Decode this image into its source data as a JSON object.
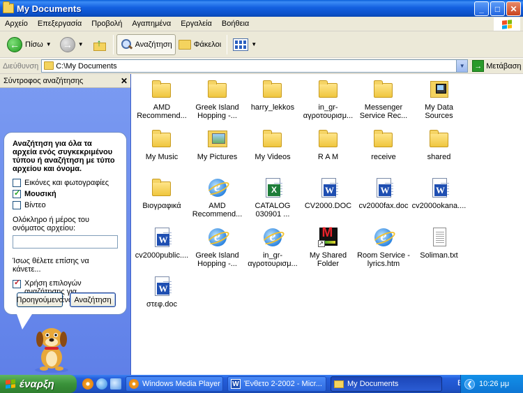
{
  "window": {
    "title": "My Documents",
    "min": "_",
    "max": "□",
    "close": "✕"
  },
  "menu": [
    "Αρχείο",
    "Επεξεργασία",
    "Προβολή",
    "Αγαπημένα",
    "Εργαλεία",
    "Βοήθεια"
  ],
  "toolbar": {
    "back": "Πίσω",
    "search": "Αναζήτηση",
    "folders": "Φάκελοι"
  },
  "address": {
    "label": "Διεύθυνση",
    "value": "C:\\My Documents",
    "go": "Μετάβαση"
  },
  "search_pane": {
    "title": "Σύντροφος αναζήτησης",
    "close": "✕",
    "heading": "Αναζήτηση για όλα τα αρχεία ενός συγκεκριμένου τύπου ή αναζήτηση με τύπο αρχείου και όνομα.",
    "options": [
      {
        "label": "Εικόνες και φωτογραφίες",
        "checked": false,
        "bold": false
      },
      {
        "label": "Μουσική",
        "checked": true,
        "bold": true
      },
      {
        "label": "Βίντεο",
        "checked": false,
        "bold": false
      }
    ],
    "name_label": "Ολόκληρο ή μέρος του ονόματος αρχείου:",
    "name_value": "",
    "maybe": "Ίσως θέλετε επίσης να κάνετε...",
    "advanced": "Χρήση επιλογών αναζήτησης για προχωρημένους",
    "back_button": "Προηγούμενο",
    "search_button": "Αναζήτηση"
  },
  "files": [
    {
      "name": "AMD Recommend...",
      "icon": "folder"
    },
    {
      "name": "Greek Island Hopping -...",
      "icon": "folder"
    },
    {
      "name": "harry_lekkos",
      "icon": "folder"
    },
    {
      "name": "in_gr-αγροτουρισμ...",
      "icon": "folder"
    },
    {
      "name": "Messenger Service Rec...",
      "icon": "folder"
    },
    {
      "name": "My Data Sources",
      "icon": "data-sources"
    },
    {
      "name": "My Music",
      "icon": "folder"
    },
    {
      "name": "My Pictures",
      "icon": "pictures"
    },
    {
      "name": "My Videos",
      "icon": "folder"
    },
    {
      "name": "R A M",
      "icon": "folder"
    },
    {
      "name": "receive",
      "icon": "folder"
    },
    {
      "name": "shared",
      "icon": "folder"
    },
    {
      "name": "Βιογραφικά",
      "icon": "folder"
    },
    {
      "name": "AMD Recommend...",
      "icon": "ie"
    },
    {
      "name": "CATALOG 030901 ...",
      "icon": "excel"
    },
    {
      "name": "CV2000.DOC",
      "icon": "word"
    },
    {
      "name": "cv2000fax.doc",
      "icon": "word"
    },
    {
      "name": "cv2000okana....",
      "icon": "word"
    },
    {
      "name": "cv2000public....",
      "icon": "word"
    },
    {
      "name": "Greek Island Hopping -...",
      "icon": "ie"
    },
    {
      "name": "in_gr-αγροτουρισμ...",
      "icon": "ie"
    },
    {
      "name": "My Shared Folder",
      "icon": "msn-shortcut"
    },
    {
      "name": "Room Service - lyrics.htm",
      "icon": "ie"
    },
    {
      "name": "Soliman.txt",
      "icon": "text"
    },
    {
      "name": "στεφ.doc",
      "icon": "word"
    }
  ],
  "taskbar": {
    "start": "έναρξη",
    "tasks": [
      {
        "label": "Windows Media Player",
        "active": false
      },
      {
        "label": "Ένθετο 2-2002 - Micr...",
        "active": false
      },
      {
        "label": "My Documents",
        "active": true
      }
    ],
    "lang": "EN",
    "tray_arrow": "❮",
    "clock": "10:26 μμ"
  },
  "colors": {
    "title_bar": "#0b50c8",
    "left_pane": "#6e8ff0",
    "taskbar": "#245edb",
    "start": "#3a923a"
  }
}
